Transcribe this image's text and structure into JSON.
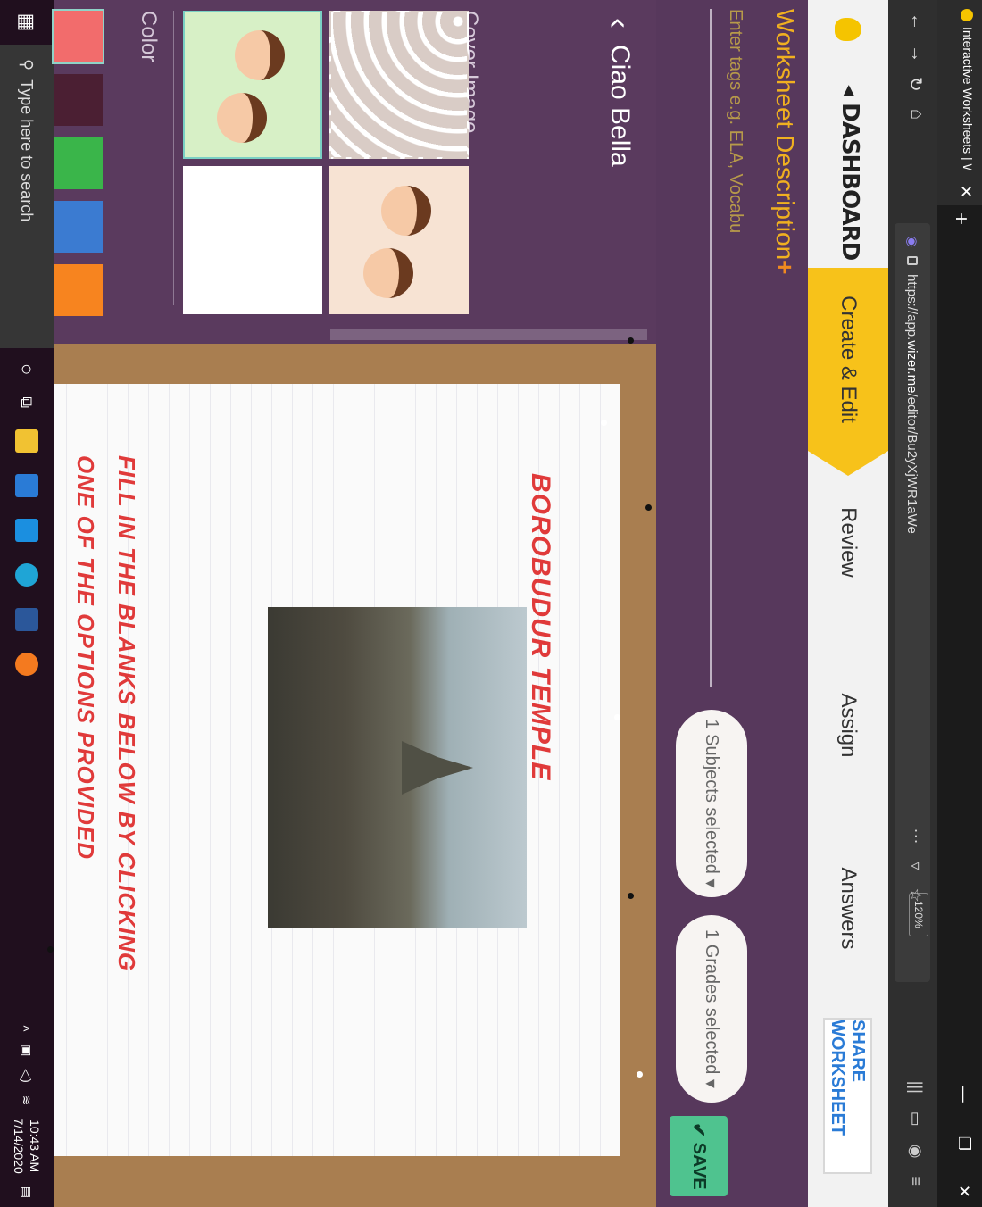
{
  "browser": {
    "tab_title": "Interactive Worksheets | Wizer.",
    "new_tab": "+",
    "url_prefix": "https://app.",
    "url_domain": "wizer.me",
    "url_path": "/editor/Bu2yXjWR1aWe",
    "zoom": "120%"
  },
  "header": {
    "dashboard": "DASHBOARD",
    "tabs": [
      "Create & Edit",
      "Review",
      "Assign",
      "Answers"
    ],
    "share": "SHARE WORKSHEET"
  },
  "description": {
    "title": "Worksheet Description",
    "plus": "+",
    "tags_placeholder": "Enter tags e.g. ELA, Vocabu",
    "subjects": "1 Subjects selected",
    "grades": "1 Grades selected",
    "save": "SAVE"
  },
  "panel": {
    "back_label": "Ciao Bella",
    "cover_label": "Cover Image",
    "color_label": "Color",
    "colors": [
      "#f26c6c",
      "#4b1f33",
      "#3ab54a",
      "#3b7bd1",
      "#f7841f"
    ]
  },
  "worksheet": {
    "title": "BOROBUDUR TEMPLE",
    "instruction": "FILL IN THE BLANKS BELOW BY CLICKING ONE OF THE OPTIONS PROVIDED"
  },
  "taskbar": {
    "search_placeholder": "Type here to search",
    "time": "10:43 AM",
    "date": "7/14/2020"
  }
}
